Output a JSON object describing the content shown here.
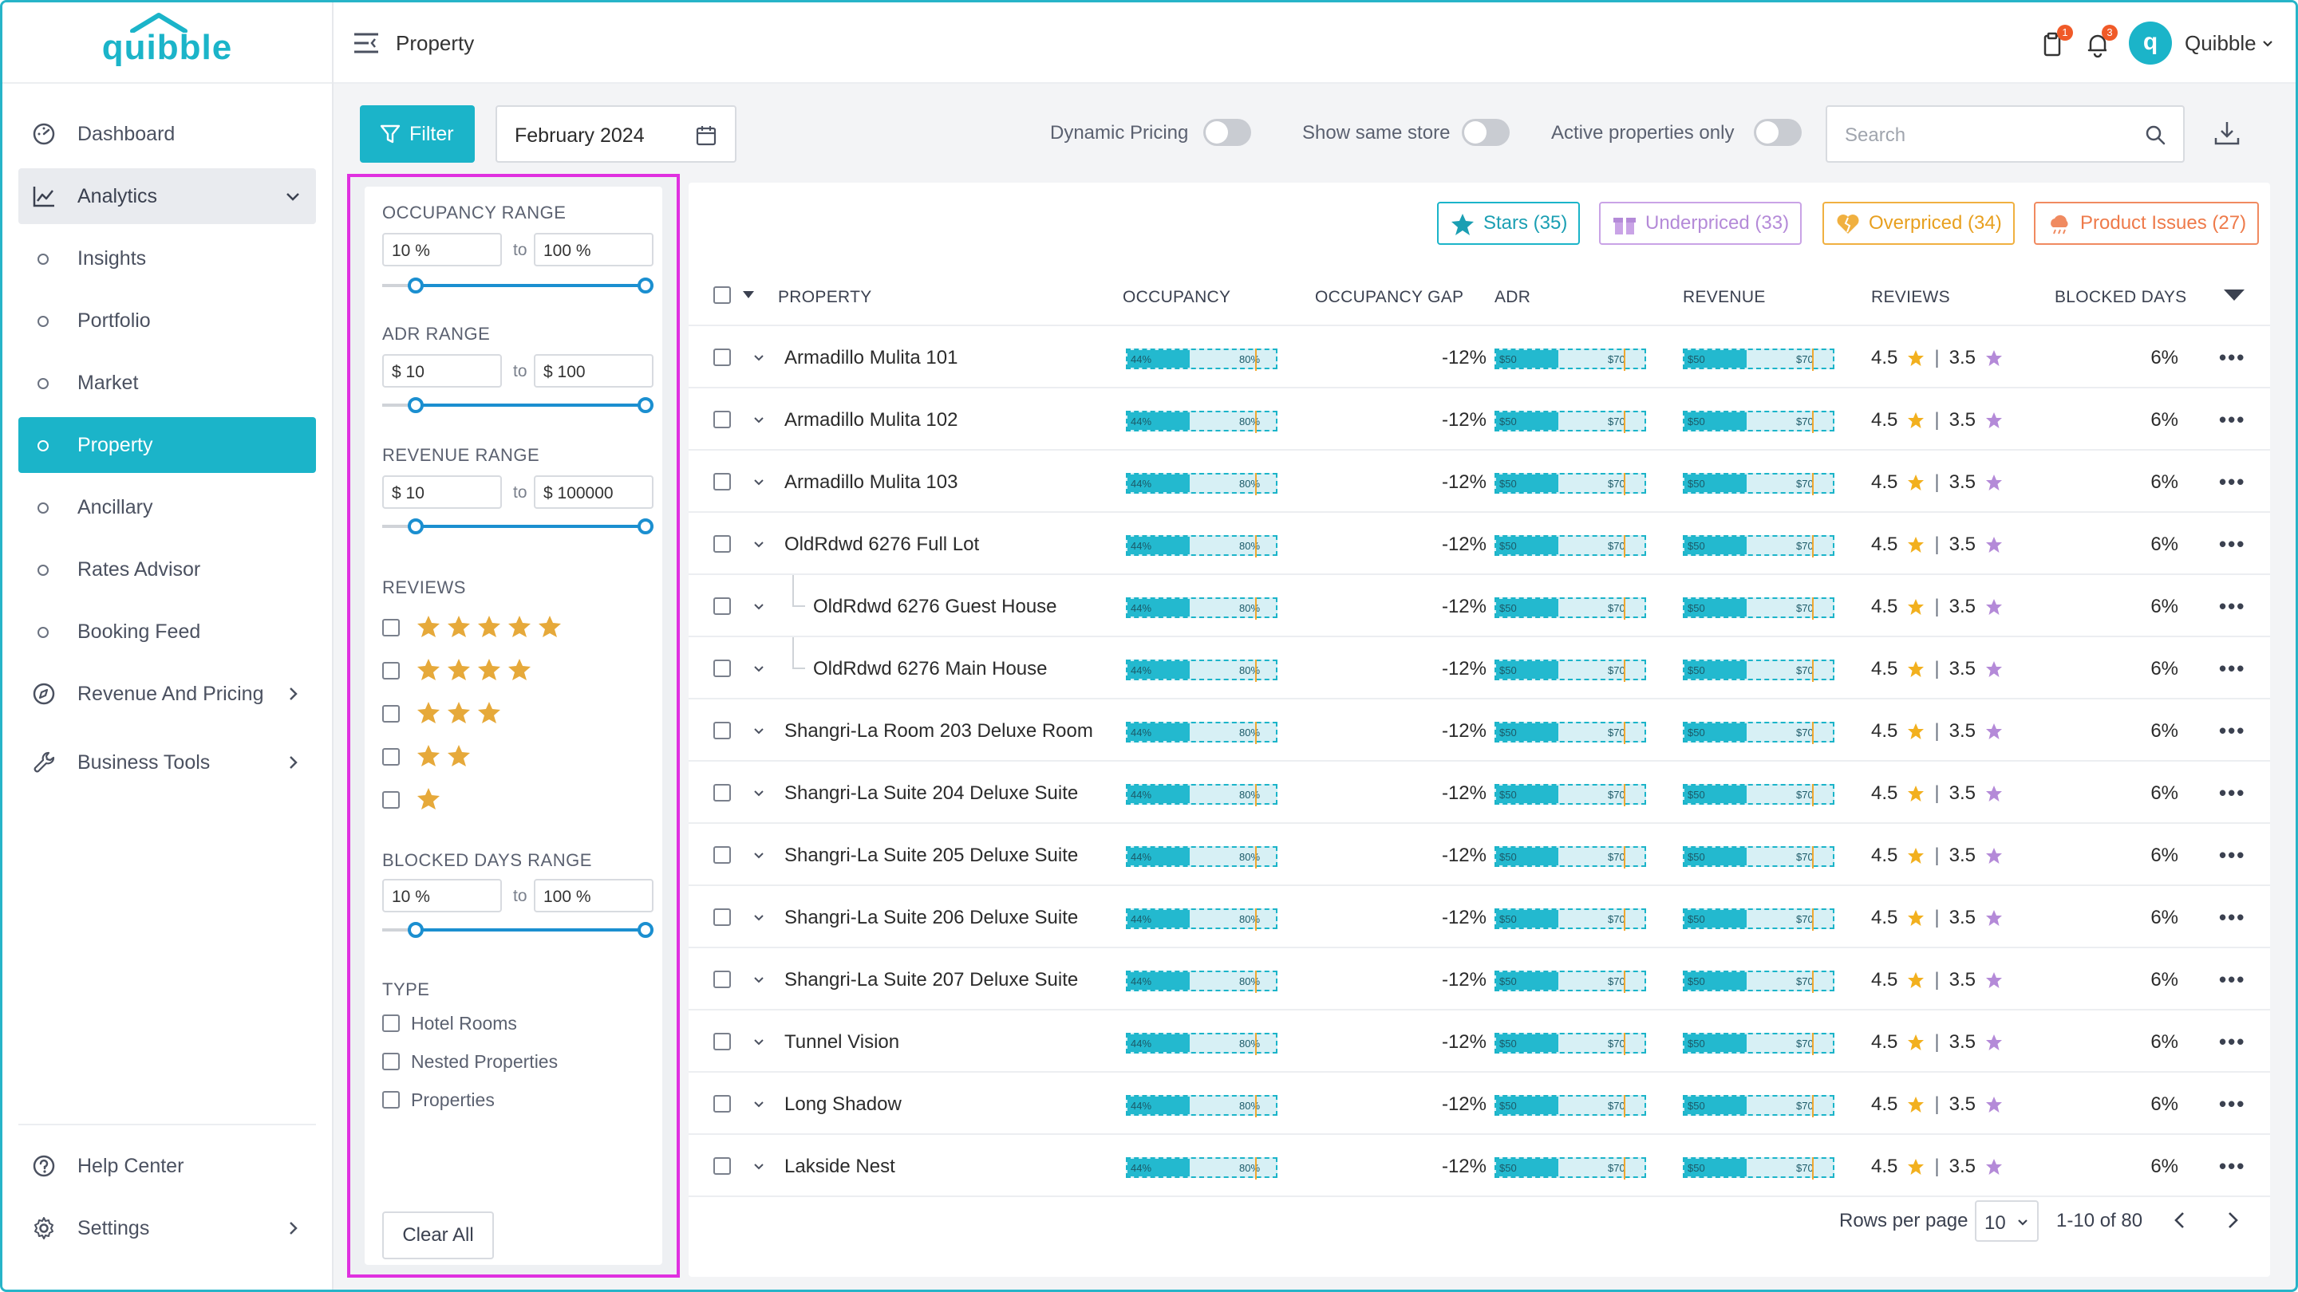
{
  "app": {
    "brand": "quibble",
    "accent": "#1bb4c9"
  },
  "sidebar": {
    "dashboard": "Dashboard",
    "analytics": "Analytics",
    "insights": "Insights",
    "portfolio": "Portfolio",
    "market": "Market",
    "property": "Property",
    "ancillary": "Ancillary",
    "rates_advisor": "Rates Advisor",
    "booking_feed": "Booking Feed",
    "revenue_pricing": "Revenue And Pricing",
    "business_tools": "Business Tools",
    "help_center": "Help Center",
    "settings": "Settings"
  },
  "header": {
    "title": "Property",
    "clipboard_badge": "1",
    "bell_badge": "3",
    "avatar_letter": "q",
    "user_name": "Quibble"
  },
  "toolbar": {
    "filter_label": "Filter",
    "date_value": "February 2024",
    "dynamic_pricing": "Dynamic Pricing",
    "show_same_store": "Show same store",
    "active_only": "Active properties only",
    "search_placeholder": "Search"
  },
  "filters": {
    "occupancy_title": "OCCUPANCY RANGE",
    "occupancy_min": "10 %",
    "occupancy_max": "100 %",
    "adr_title": "ADR RANGE",
    "adr_min": "$ 10",
    "adr_max": "$ 100",
    "revenue_title": "REVENUE RANGE",
    "revenue_min": "$ 10",
    "revenue_max": "$ 100000",
    "to": "to",
    "reviews_title": "REVIEWS",
    "blocked_title": "BLOCKED DAYS RANGE",
    "blocked_min": "10 %",
    "blocked_max": "100 %",
    "type_title": "TYPE",
    "type_hotel": "Hotel Rooms",
    "type_nested": "Nested Properties",
    "type_properties": "Properties",
    "clear_all": "Clear All"
  },
  "chips": {
    "stars": "Stars (35)",
    "underpriced": "Underpriced (33)",
    "overpriced": "Overpriced (34)",
    "issues": "Product Issues (27)"
  },
  "columns": {
    "property": "PROPERTY",
    "occupancy": "OCCUPANCY",
    "gap": "OCCUPANCY GAP",
    "adr": "ADR",
    "revenue": "REVENUE",
    "reviews": "REVIEWS",
    "blocked": "BLOCKED DAYS"
  },
  "mini_labels": {
    "occ_a": "44%",
    "occ_b": "80%",
    "adr_a": "$50",
    "adr_b": "$70",
    "rev_a": "$50",
    "rev_b": "$70"
  },
  "rows": [
    {
      "name": "Armadillo  Mulita 101",
      "gap": "-12%",
      "review_a": "4.5",
      "review_b": "3.5",
      "blocked": "6%"
    },
    {
      "name": "Armadillo Mulita 102",
      "gap": "-12%",
      "review_a": "4.5",
      "review_b": "3.5",
      "blocked": "6%"
    },
    {
      "name": "Armadillo Mulita 103",
      "gap": "-12%",
      "review_a": "4.5",
      "review_b": "3.5",
      "blocked": "6%"
    },
    {
      "name": "OldRdwd 6276 Full Lot",
      "gap": "-12%",
      "review_a": "4.5",
      "review_b": "3.5",
      "blocked": "6%"
    },
    {
      "name": "OldRdwd 6276 Guest House",
      "gap": "-12%",
      "review_a": "4.5",
      "review_b": "3.5",
      "blocked": "6%"
    },
    {
      "name": "OldRdwd 6276 Main House",
      "gap": "-12%",
      "review_a": "4.5",
      "review_b": "3.5",
      "blocked": "6%"
    },
    {
      "name": "Shangri-La Room  203 Deluxe Room",
      "gap": "-12%",
      "review_a": "4.5",
      "review_b": "3.5",
      "blocked": "6%"
    },
    {
      "name": "Shangri-La Suite  204 Deluxe Suite",
      "gap": "-12%",
      "review_a": "4.5",
      "review_b": "3.5",
      "blocked": "6%"
    },
    {
      "name": "Shangri-La Suite  205 Deluxe Suite",
      "gap": "-12%",
      "review_a": "4.5",
      "review_b": "3.5",
      "blocked": "6%"
    },
    {
      "name": "Shangri-La Suite  206 Deluxe Suite",
      "gap": "-12%",
      "review_a": "4.5",
      "review_b": "3.5",
      "blocked": "6%"
    },
    {
      "name": "Shangri-La Suite  207 Deluxe Suite",
      "gap": "-12%",
      "review_a": "4.5",
      "review_b": "3.5",
      "blocked": "6%"
    },
    {
      "name": "Tunnel Vision",
      "gap": "-12%",
      "review_a": "4.5",
      "review_b": "3.5",
      "blocked": "6%"
    },
    {
      "name": "Long Shadow",
      "gap": "-12%",
      "review_a": "4.5",
      "review_b": "3.5",
      "blocked": "6%"
    },
    {
      "name": "Lakside Nest",
      "gap": "-12%",
      "review_a": "4.5",
      "review_b": "3.5",
      "blocked": "6%"
    }
  ],
  "pagination": {
    "rows_per_page_label": "Rows per page",
    "rows_per_page": "10",
    "range": "1-10 of 80"
  }
}
